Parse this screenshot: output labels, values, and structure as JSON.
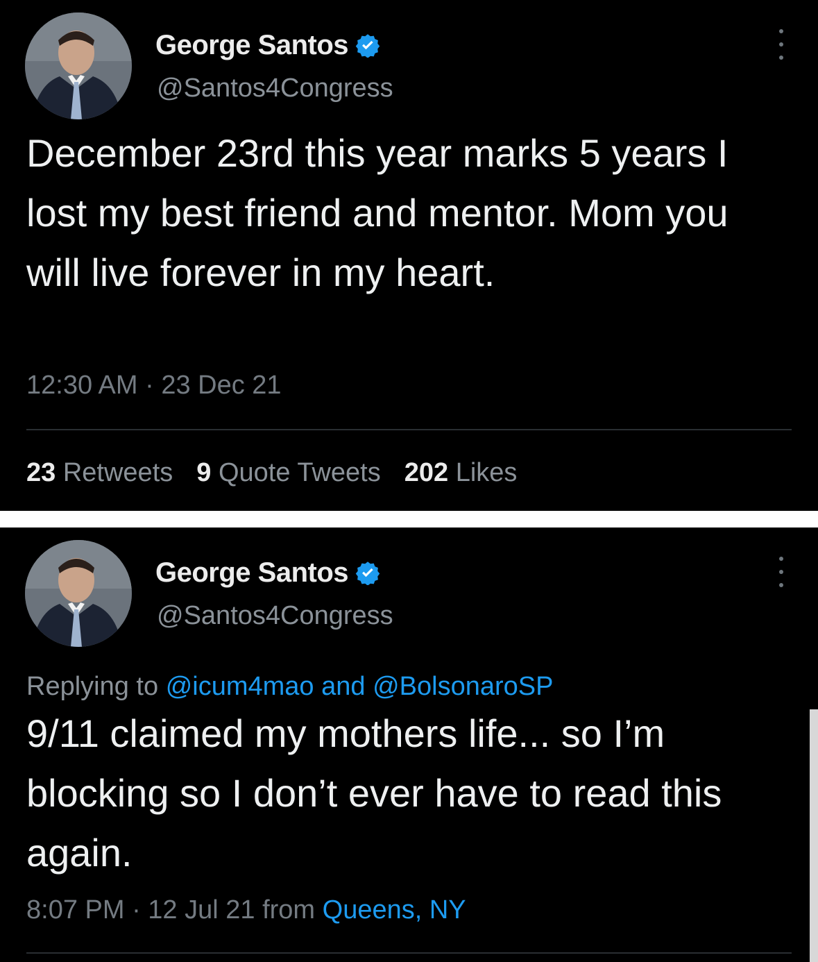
{
  "tweets": [
    {
      "author": {
        "name": "George Santos",
        "handle": "@Santos4Congress",
        "verified": true
      },
      "text": "December 23rd this year marks 5 years I lost my best friend and mentor. Mom you will live forever in my heart.",
      "timestamp": "12:30 AM · 23 Dec 21",
      "stats": {
        "retweets": {
          "count": "23",
          "label": "Retweets"
        },
        "quotes": {
          "count": "9",
          "label": "Quote Tweets"
        },
        "likes": {
          "count": "202",
          "label": "Likes"
        }
      }
    },
    {
      "author": {
        "name": "George Santos",
        "handle": "@Santos4Congress",
        "verified": true
      },
      "reply": {
        "prefix": "Replying to",
        "user1": "@icum4mao",
        "conj": "and",
        "user2": "@BolsonaroSP"
      },
      "text": "9/11 claimed my mothers life... so I’m blocking so I don’t ever have to read this again.",
      "timestamp": "8:07 PM · 12 Jul 21",
      "from_label": "from",
      "location": "Queens, NY"
    }
  ],
  "colors": {
    "background": "#000000",
    "link": "#1d9bf0",
    "verified": "#1d9bf0",
    "muted": "#8b9299"
  },
  "icons": [
    "verified-badge-icon",
    "more-options-icon",
    "avatar"
  ]
}
